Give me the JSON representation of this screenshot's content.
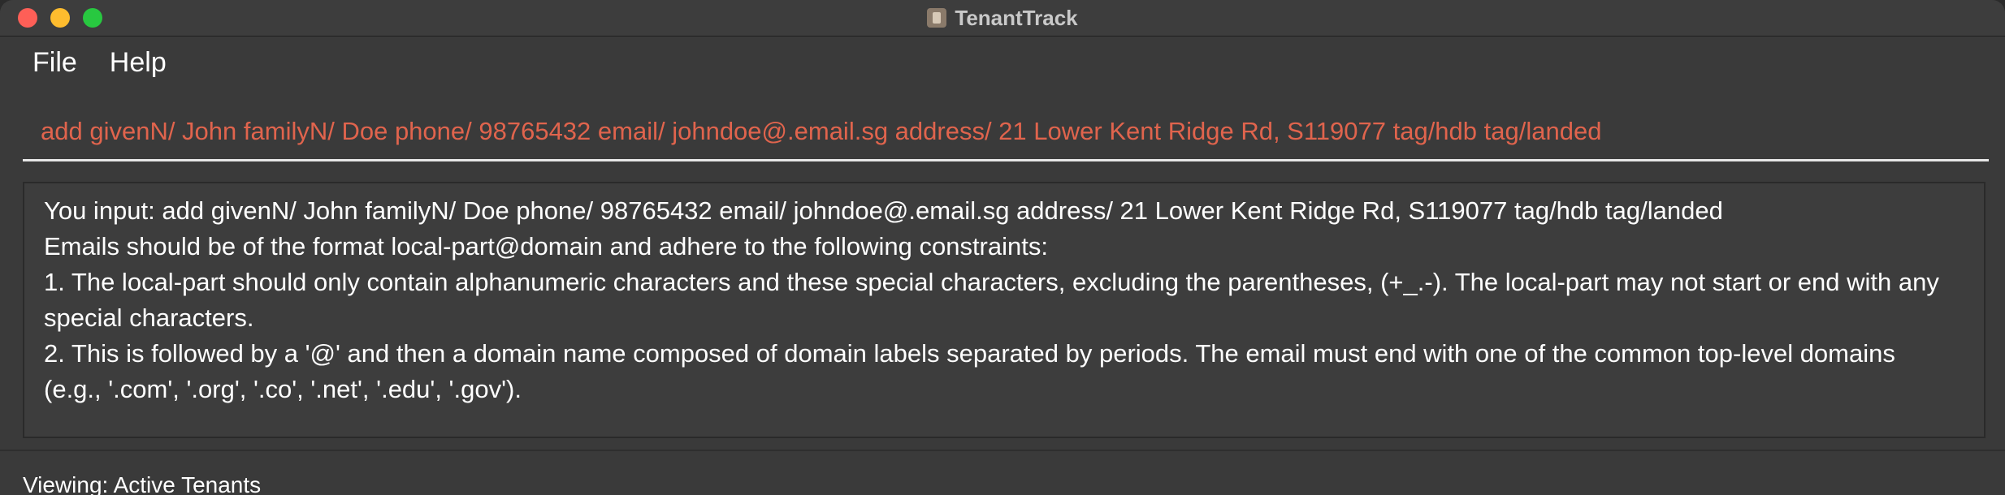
{
  "window": {
    "title": "TenantTrack"
  },
  "menu": {
    "items": [
      "File",
      "Help"
    ]
  },
  "command_box": {
    "value": "add givenN/ John familyN/ Doe phone/ 98765432 email/ johndoe@.email.sg address/ 21 Lower Kent Ridge Rd, S119077 tag/hdb tag/landed"
  },
  "result": {
    "lines": [
      "You input: add givenN/ John familyN/ Doe phone/ 98765432 email/ johndoe@.email.sg address/ 21 Lower Kent Ridge Rd, S119077 tag/hdb tag/landed",
      "Emails should be of the format local-part@domain and adhere to the following constraints:",
      "1. The local-part should only contain alphanumeric characters and these special characters, excluding the parentheses, (+_.-). The local-part may not start or end with any special characters.",
      "2. This is followed by a '@' and then a domain name composed of domain labels separated by periods. The email must end with one of the common top-level domains (e.g., '.com', '.org', '.co', '.net', '.edu', '.gov')."
    ]
  },
  "status": {
    "text": "Viewing: Active Tenants"
  },
  "colors": {
    "command_text": "#e0644d",
    "background": "#3a3a3a"
  }
}
